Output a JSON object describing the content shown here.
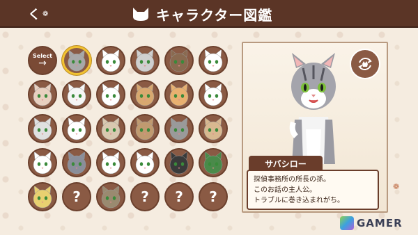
{
  "header": {
    "title": "キャラクター図鑑",
    "back_label": "く",
    "paw_glyph": "❁"
  },
  "grid": {
    "select_label": "Select",
    "select_arrow": "→",
    "unknown_label": "?",
    "cells": [
      {
        "kind": "select"
      },
      {
        "kind": "cat",
        "fur": "#a8a8a8",
        "selected": true
      },
      {
        "kind": "cat",
        "fur": "#ffffff"
      },
      {
        "kind": "cat",
        "fur": "#cfcfcf"
      },
      {
        "kind": "cat",
        "fur": "#8a6a50"
      },
      {
        "kind": "cat",
        "fur": "#ffffff"
      },
      {
        "kind": "cat",
        "fur": "#e8d0c0"
      },
      {
        "kind": "cat",
        "fur": "#f5f5f5"
      },
      {
        "kind": "cat",
        "fur": "#ffffff"
      },
      {
        "kind": "cat",
        "fur": "#d8a870"
      },
      {
        "kind": "cat",
        "fur": "#e8b070"
      },
      {
        "kind": "cat",
        "fur": "#ffffff"
      },
      {
        "kind": "cat",
        "fur": "#e0e0e0"
      },
      {
        "kind": "cat",
        "fur": "#ffffff"
      },
      {
        "kind": "cat",
        "fur": "#d8c8b0"
      },
      {
        "kind": "cat",
        "fur": "#c09a70"
      },
      {
        "kind": "cat",
        "fur": "#9a9a9a"
      },
      {
        "kind": "cat",
        "fur": "#d8b890"
      },
      {
        "kind": "cat",
        "fur": "#ffffff"
      },
      {
        "kind": "cat",
        "fur": "#8a8e9a"
      },
      {
        "kind": "cat",
        "fur": "#ffffff"
      },
      {
        "kind": "cat",
        "fur": "#ffffff"
      },
      {
        "kind": "cat",
        "fur": "#3a3a3a"
      },
      {
        "kind": "cat",
        "fur": "#4a8a4a"
      },
      {
        "kind": "cat",
        "fur": "#e8d070"
      },
      {
        "kind": "unknown"
      },
      {
        "kind": "cat",
        "fur": "#9a8a70"
      },
      {
        "kind": "unknown"
      },
      {
        "kind": "unknown"
      },
      {
        "kind": "unknown"
      }
    ]
  },
  "detail": {
    "name": "サバシロー",
    "desc_lines": [
      "探偵事務所の所長の孫。",
      "このお話の主人公。",
      "トラブルに巻き込まれがち。"
    ],
    "swap_icon": "swap-cat-icon"
  },
  "watermark": {
    "text": "GAMER"
  },
  "colors": {
    "header_bg": "#5b3526",
    "cell_bg": "#8a5a44",
    "selected_ring": "#f2c232",
    "panel_bg": "#fff8ee"
  }
}
